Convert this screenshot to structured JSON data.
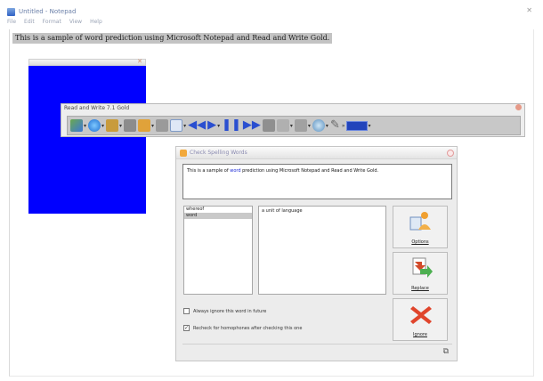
{
  "notepad": {
    "title": "Untitled - Notepad",
    "menu": [
      "File",
      "Edit",
      "Format",
      "View",
      "Help"
    ],
    "text": "This is a sample of word prediction using Microsoft Notepad and Read and Write Gold."
  },
  "read_write": {
    "title": "Read and Write 7.1 Gold",
    "icons": [
      "check-icon",
      "globe-icon",
      "book-icon",
      "speaker-icon",
      "people-icon",
      "speaker-icon",
      "page-icon",
      "rewind-icon",
      "play-icon",
      "pause-icon",
      "forward-icon",
      "stop-icon",
      "calculator-icon",
      "highlighter-icon",
      "magnifier-icon",
      "pen-icon",
      "expand-icon"
    ],
    "colors": {
      "accent": "#2244bb"
    }
  },
  "dialog": {
    "title": "Check Spelling Words",
    "sentence_before": "This is a sample of ",
    "sentence_word": "word",
    "sentence_after": " prediction using Microsoft Notepad and Read and Write Gold.",
    "suggestions": [
      "whereof",
      "word"
    ],
    "selected_index": 1,
    "definition": "a unit of language",
    "buttons": {
      "options": "Options",
      "replace": "Replace",
      "ignore": "Ignore"
    },
    "checkboxes": [
      {
        "label": "Always ignore this word in future",
        "checked": false
      },
      {
        "label": "Recheck for homophones after checking this one",
        "checked": true
      }
    ]
  },
  "colors": {
    "blue_panel": "#0000ff"
  }
}
